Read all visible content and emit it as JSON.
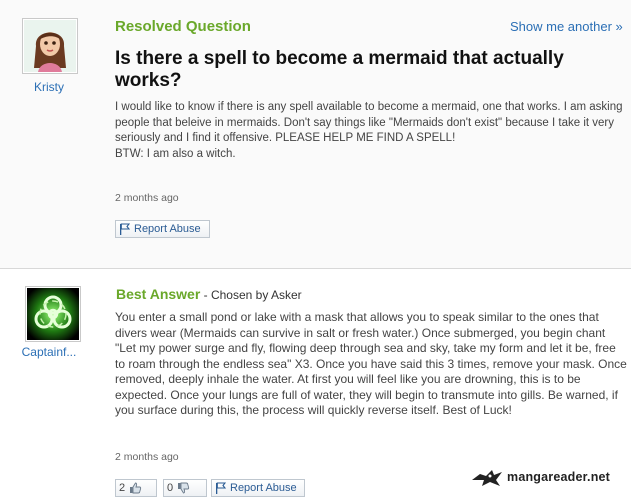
{
  "question": {
    "heading": "Resolved Question",
    "show_another": "Show me another »",
    "title": "Is there a spell to become a mermaid that actually works?",
    "body": "I would like to know if there is any spell available to become a mermaid, one that works. I am asking people that beleive in mermaids. Don't say things like \"Mermaids don't exist\" because I take it very seriously and I find it offensive. PLEASE HELP ME FIND A SPELL!\nBTW: I am also a witch.",
    "timestamp": "2 months ago",
    "report": "Report Abuse",
    "asker": {
      "name": "Kristy",
      "avatar": "girl-avatar-icon"
    }
  },
  "answer": {
    "heading": "Best Answer",
    "chosen_by": " - Chosen by Asker",
    "body": "You enter a small pond or lake with a mask that allows you to speak similar to the ones that divers wear (Mermaids can survive in salt or fresh water.) Once submerged, you begin chant \"Let my power surge and fly, flowing deep through sea and sky, take my form and let it be, free to roam through the endless sea\" X3. Once you have said this 3 times, remove your mask. Once removed, deeply inhale the water. At first you will feel like you are drowning, this is to be expected. Once your lungs are full of water, they will begin to transmute into gills. Be warned, if you surface during this, the process will quickly reverse itself. Best of Luck!",
    "timestamp": "2 months ago",
    "thumbs_up": "2",
    "thumbs_down": "0",
    "report": "Report Abuse",
    "answerer": {
      "name": "Captainf...",
      "avatar": "biohazard-avatar-icon"
    }
  },
  "watermark": "mangareader.net",
  "colors": {
    "green": "#6aa82a",
    "link": "#2b6fb5"
  }
}
